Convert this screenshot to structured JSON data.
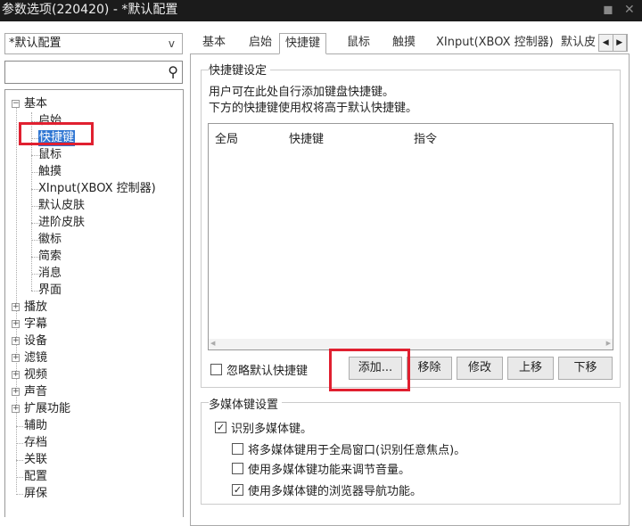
{
  "window": {
    "title": "参数选项(220420) - *默认配置",
    "pin_icon": "pin-icon",
    "close_icon": "close-icon"
  },
  "profile": {
    "selected": "*默认配置",
    "chevron": "v"
  },
  "search": {
    "value": "",
    "placeholder": "",
    "icon": "magnifier-icon"
  },
  "tree": {
    "root": "基本",
    "children": [
      "启始",
      "快捷键",
      "鼠标",
      "触摸",
      "XInput(XBOX 控制器)",
      "默认皮肤",
      "进阶皮肤",
      "徽标",
      "简索",
      "消息",
      "界面"
    ],
    "selected": "快捷键",
    "collapsed": [
      "播放",
      "字幕",
      "设备",
      "滤镜",
      "视频",
      "声音",
      "扩展功能"
    ],
    "leaves": [
      "辅助",
      "存档",
      "关联",
      "配置",
      "屏保"
    ]
  },
  "tabs": [
    "基本",
    "启始",
    "快捷键",
    "鼠标",
    "触摸",
    "XInput(XBOX 控制器)",
    "默认皮"
  ],
  "active_tab": "快捷键",
  "hotkeys": {
    "group_title": "快捷键设定",
    "desc1": "用户可在此处自行添加键盘快捷键。",
    "desc2": "下方的快捷键使用权将高于默认快捷键。",
    "columns": [
      "全局",
      "快捷键",
      "指令"
    ],
    "rows": [],
    "ignore_default": {
      "label": "忽略默认快捷键",
      "checked": false
    },
    "buttons": {
      "add": "添加...",
      "remove": "移除",
      "edit": "修改",
      "up": "上移",
      "down": "下移"
    }
  },
  "multimedia": {
    "group_title": "多媒体键设置",
    "options": [
      {
        "label": "识别多媒体键。",
        "checked": true
      },
      {
        "label": "将多媒体键用于全局窗口(识别任意焦点)。",
        "checked": false
      },
      {
        "label": "使用多媒体键功能来调节音量。",
        "checked": false
      },
      {
        "label": "使用多媒体键的浏览器导航功能。",
        "checked": true
      }
    ]
  },
  "colors": {
    "selection": "#3077d3",
    "highlight_box": "#e02030",
    "titlebar": "#1b1b1b"
  }
}
